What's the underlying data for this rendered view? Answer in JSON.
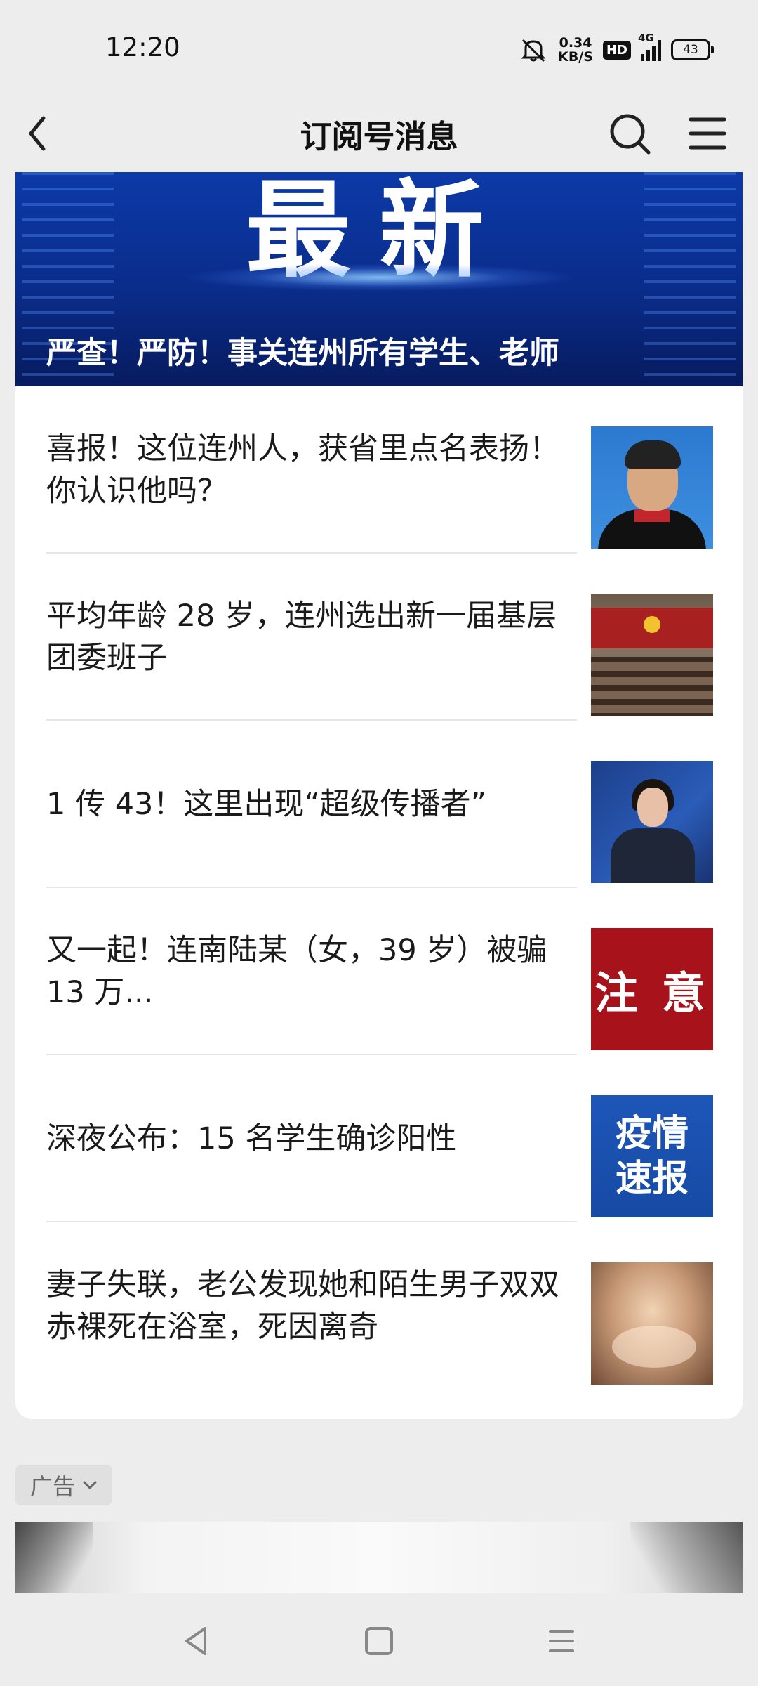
{
  "status_bar": {
    "time": "12:20",
    "net_speed_value": "0.34",
    "net_speed_unit": "KB/S",
    "hd": "HD",
    "network": "4G",
    "battery": "43"
  },
  "header": {
    "title": "订阅号消息",
    "back_icon": "chevron-left-icon",
    "search_icon": "search-icon",
    "menu_icon": "menu-icon"
  },
  "banner": {
    "big_text": "最新",
    "title": "严查！严防！事关连州所有学生、老师"
  },
  "articles": [
    {
      "title": "喜报！这位连州人，获省里点名表扬！你认识他吗？"
    },
    {
      "title": "平均年龄 28 岁，连州选出新一届基层团委班子"
    },
    {
      "title": "1 传 43！这里出现“超级传播者”"
    },
    {
      "title": "又一起！连南陆某（女，39 岁）被骗 13 万...",
      "thumb_text": "注 意"
    },
    {
      "title": "深夜公布：15 名学生确诊阳性",
      "thumb_line1": "疫情",
      "thumb_line2": "速报"
    },
    {
      "title": "妻子失联，老公发现她和陌生男子双双赤裸死在浴室，死因离奇"
    }
  ],
  "ad": {
    "tag": "广告"
  },
  "colors": {
    "background": "#ededed",
    "banner_blue": "#0c3aa8",
    "attention_red": "#a8121a"
  }
}
